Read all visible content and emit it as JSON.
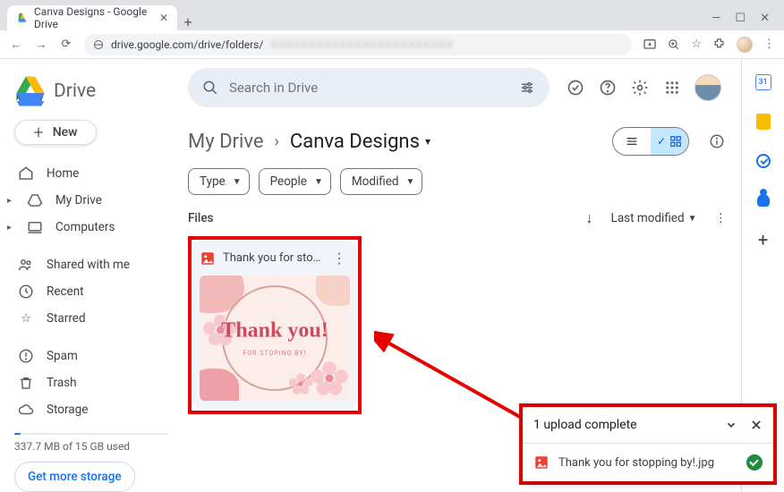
{
  "browser": {
    "tab_title": "Canva Designs - Google Drive",
    "url_prefix": "drive.google.com/drive/folders/",
    "url_blur": "XXXXXXXXXXXXXXXXXXXXXXXX"
  },
  "app": {
    "product": "Drive",
    "search_placeholder": "Search in Drive",
    "new_button": "New"
  },
  "sidebar": {
    "items": [
      {
        "label": "Home"
      },
      {
        "label": "My Drive"
      },
      {
        "label": "Computers"
      },
      {
        "label": "Shared with me"
      },
      {
        "label": "Recent"
      },
      {
        "label": "Starred"
      },
      {
        "label": "Spam"
      },
      {
        "label": "Trash"
      },
      {
        "label": "Storage"
      }
    ],
    "quota_text": "337.7 MB of 15 GB used",
    "get_more": "Get more storage"
  },
  "breadcrumb": {
    "root": "My Drive",
    "current": "Canva Designs"
  },
  "filters": {
    "type": "Type",
    "people": "People",
    "modified": "Modified"
  },
  "files": {
    "section_label": "Files",
    "sort_label": "Last modified",
    "cards": [
      {
        "name": "Thank you for sto…",
        "thumb_main": "Thank you!",
        "thumb_sub": "FOR STOPING BY!"
      }
    ]
  },
  "toast": {
    "title": "1 upload complete",
    "row_filename": "Thank you for stopping by!.jpg"
  },
  "rail": {
    "calendar_day": "31"
  }
}
